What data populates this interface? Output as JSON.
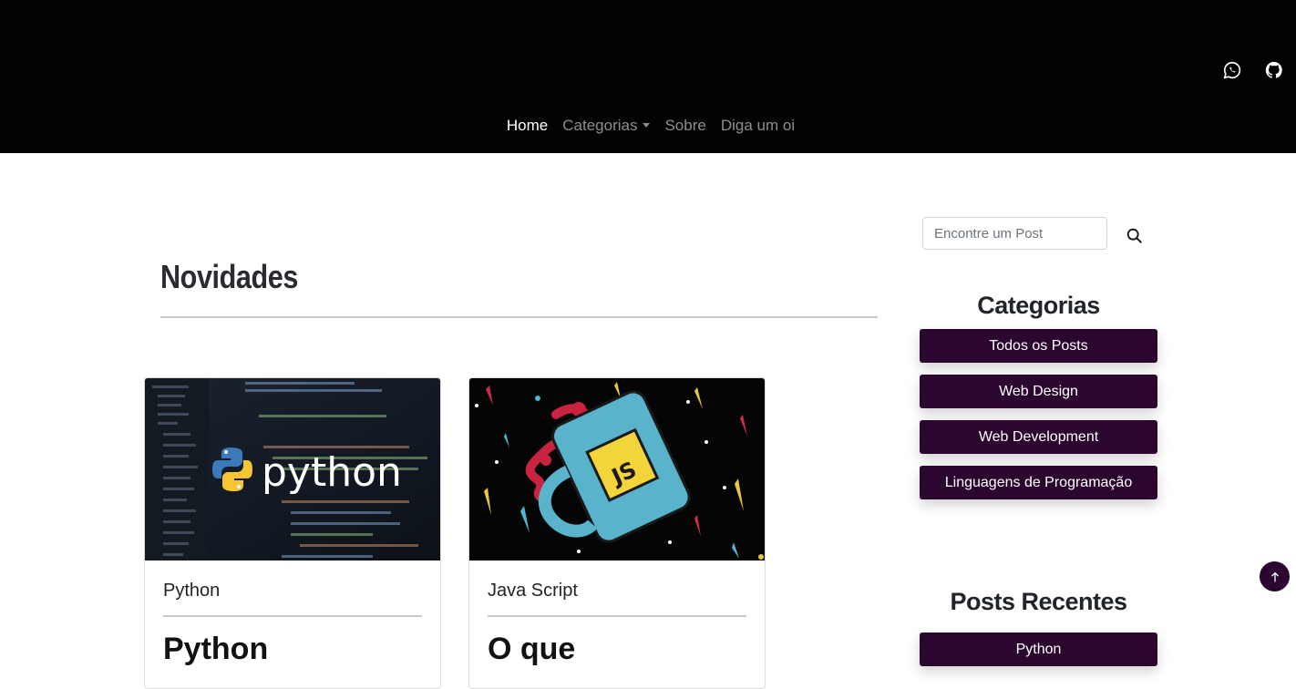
{
  "nav": {
    "items": [
      {
        "label": "Home",
        "active": true
      },
      {
        "label": "Categorias",
        "dropdown": true
      },
      {
        "label": "Sobre"
      },
      {
        "label": "Diga um oi"
      }
    ]
  },
  "social": {
    "icons": [
      "whatsapp-icon",
      "github-icon"
    ]
  },
  "main": {
    "section_title": "Novidades",
    "posts": [
      {
        "category": "Python",
        "title": "Python",
        "image": "python-code-image"
      },
      {
        "category": "Java Script",
        "title": "O que",
        "image": "javascript-mug-image"
      }
    ]
  },
  "sidebar": {
    "search": {
      "placeholder": "Encontre um Post"
    },
    "categories_title": "Categorias",
    "categories": [
      "Todos os Posts",
      "Web Design",
      "Web Development",
      "Linguagens de Programação"
    ],
    "recent_title": "Posts Recentes",
    "recent": [
      "Python"
    ]
  },
  "colors": {
    "header_bg": "#020103",
    "accent": "#2b0730"
  }
}
